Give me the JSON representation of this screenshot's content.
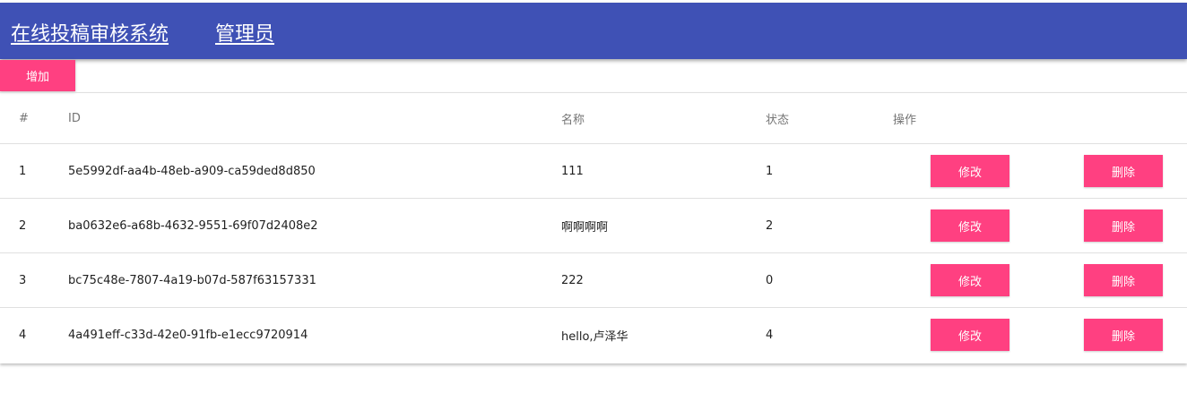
{
  "header": {
    "title": "在线投稿审核系统",
    "role": "管理员"
  },
  "toolbar": {
    "add_label": "增加"
  },
  "table": {
    "columns": [
      "#",
      "ID",
      "名称",
      "状态",
      "操作"
    ],
    "rows": [
      {
        "num": "1",
        "id": "5e5992df-aa4b-48eb-a909-ca59ded8d850",
        "name": "111",
        "status": "1",
        "edit": "修改",
        "delete": "删除"
      },
      {
        "num": "2",
        "id": "ba0632e6-a68b-4632-9551-69f07d2408e2",
        "name": "啊啊啊啊",
        "status": "2",
        "edit": "修改",
        "delete": "删除"
      },
      {
        "num": "3",
        "id": "bc75c48e-7807-4a19-b07d-587f63157331",
        "name": "222",
        "status": "0",
        "edit": "修改",
        "delete": "删除"
      },
      {
        "num": "4",
        "id": "4a491eff-c33d-42e0-91fb-e1ecc9720914",
        "name": "hello,卢泽华",
        "status": "4",
        "edit": "修改",
        "delete": "删除"
      }
    ]
  },
  "colors": {
    "header_bg": "#3f51b5",
    "accent": "#ff4081"
  }
}
